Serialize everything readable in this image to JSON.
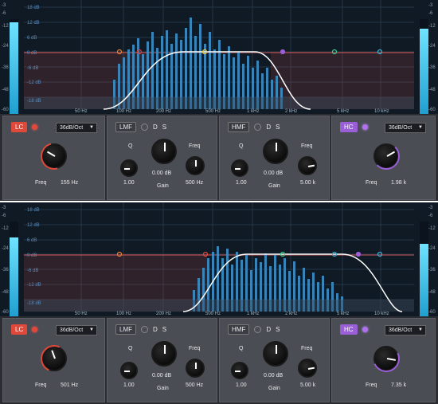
{
  "db_scale": [
    "-3",
    "-6",
    "-12",
    "-24",
    "-36",
    "-48",
    "-60"
  ],
  "plot_db_labels": [
    "18 dB",
    "12 dB",
    "6 dB",
    "0 dB",
    "-6 dB",
    "-12 dB",
    "-18 dB"
  ],
  "freq_labels": [
    "50 Hz",
    "100 Hz",
    "200 Hz",
    "500 Hz",
    "1 kHz",
    "2 kHz",
    "5 kHz",
    "10 kHz"
  ],
  "panels": [
    {
      "lc": {
        "name": "LC",
        "slope": "36dB/Oct",
        "freq_label": "Freq",
        "freq_value": "155 Hz"
      },
      "lmf": {
        "name": "LMF",
        "d": "D",
        "s": "S",
        "q_label": "Q",
        "q_value": "1.00",
        "gain_value": "0.00 dB",
        "gain_label": "Gain",
        "freq_label": "Freq",
        "freq_value": "500 Hz"
      },
      "hmf": {
        "name": "HMF",
        "d": "D",
        "s": "S",
        "q_label": "Q",
        "q_value": "1.00",
        "gain_value": "0.00 dB",
        "gain_label": "Gain",
        "freq_label": "Freq",
        "freq_value": "5.00 k"
      },
      "hc": {
        "name": "HC",
        "slope": "36dB/Oct",
        "freq_label": "Freq",
        "freq_value": "1.98 k"
      }
    },
    {
      "lc": {
        "name": "LC",
        "slope": "36dB/Oct",
        "freq_label": "Freq",
        "freq_value": "501 Hz"
      },
      "lmf": {
        "name": "LMF",
        "d": "D",
        "s": "S",
        "q_label": "Q",
        "q_value": "1.00",
        "gain_value": "0.00 dB",
        "gain_label": "Gain",
        "freq_label": "Freq",
        "freq_value": "500 Hz"
      },
      "hmf": {
        "name": "HMF",
        "d": "D",
        "s": "S",
        "q_label": "Q",
        "q_value": "1.00",
        "gain_value": "0.00 dB",
        "gain_label": "Gain",
        "freq_label": "Freq",
        "freq_value": "5.00 k"
      },
      "hc": {
        "name": "HC",
        "slope": "36dB/Oct",
        "freq_label": "Freq",
        "freq_value": "7.35 k"
      }
    }
  ],
  "colors": {
    "lc_accent": "#e0483a",
    "hc_accent": "#9a5fd6",
    "curve": "#ffffff",
    "spectrum": "#3d8fc7",
    "meter": "#2fb8ea"
  }
}
